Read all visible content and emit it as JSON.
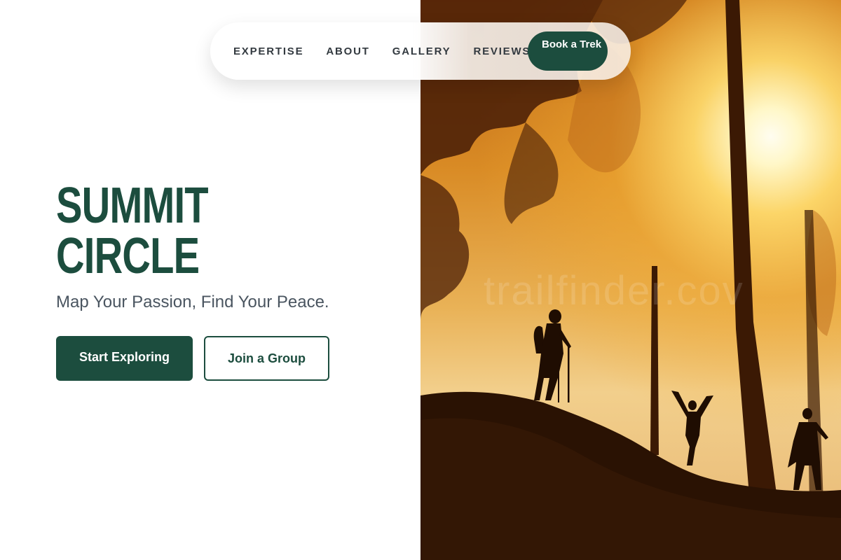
{
  "nav": {
    "links": [
      "EXPERTISE",
      "ABOUT",
      "GALLERY",
      "REVIEWS"
    ],
    "cta_label": "Book a Trek"
  },
  "hero": {
    "title_line1": "SUMMIT",
    "title_line2": "CIRCLE",
    "tagline": "Map Your Passion, Find Your Peace.",
    "primary_button": "Start Exploring",
    "secondary_button": "Join a Group"
  },
  "photo": {
    "watermark": "trailfinder.cov"
  },
  "colors": {
    "brand_green": "#1c4d3e",
    "text_gray": "#4a5560",
    "background": "#ffffff"
  }
}
